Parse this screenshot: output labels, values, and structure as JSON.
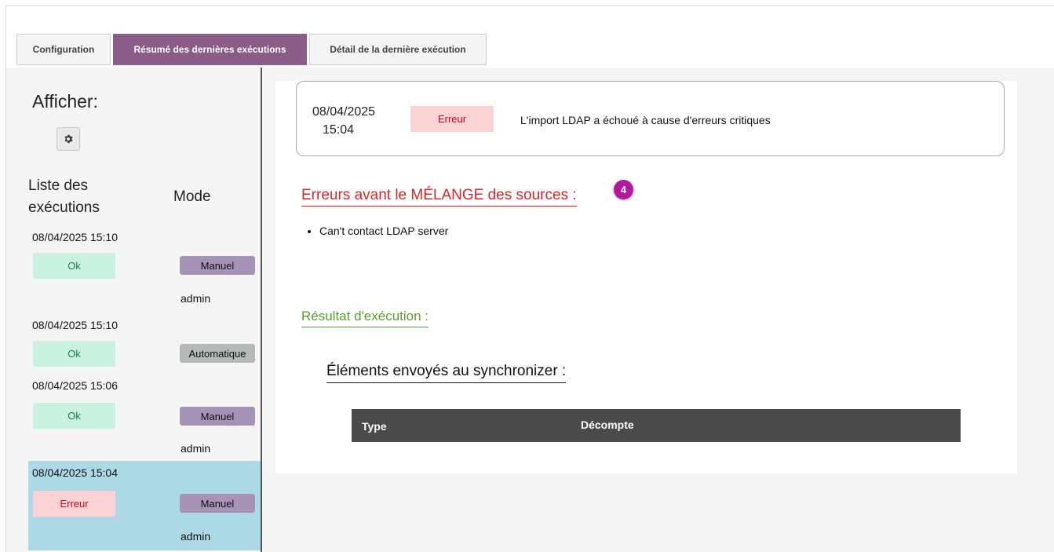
{
  "tabs": [
    {
      "label": "Configuration",
      "active": false
    },
    {
      "label": "Résumé des dernières exécutions",
      "active": true
    },
    {
      "label": "Détail de la dernière exécution",
      "active": false
    }
  ],
  "sidebar": {
    "afficher_label": "Afficher:",
    "settings_icon": "gear-icon",
    "list_header": "Liste des exécutions",
    "mode_header": "Mode",
    "runs": [
      {
        "date": "08/04/2025 15:10",
        "status": "Ok",
        "mode": "Manuel",
        "user": "admin"
      },
      {
        "date": "08/04/2025 15:10",
        "status": "Ok",
        "mode": "Automatique",
        "user": ""
      },
      {
        "date": "08/04/2025 15:06",
        "status": "Ok",
        "mode": "Manuel",
        "user": "admin"
      },
      {
        "date": "08/04/2025 15:04",
        "status": "Erreur",
        "mode": "Manuel",
        "user": "admin",
        "selected": true
      }
    ]
  },
  "detail": {
    "summary": {
      "date": "08/04/2025",
      "time": "15:04",
      "status": "Erreur",
      "message": "L'import LDAP a échoué à cause d'erreurs critiques"
    },
    "errors_title": "Erreurs avant le MÉLANGE des sources :",
    "step_badge": "4",
    "errors": [
      "Can't contact LDAP server"
    ],
    "result_title": "Résultat d'exécution :",
    "sync_title": "Éléments envoyés au synchronizer :",
    "table_headers": [
      "Type",
      "Décompte"
    ]
  },
  "colors": {
    "accent": "#8b5c87",
    "ok_bg": "#c9f3e0",
    "error_bg": "#fbd3d5",
    "manual_bg": "#a792b8",
    "auto_bg": "#b5bab6",
    "selected_bg": "#add8e6",
    "error_title": "#d62828",
    "result_title": "#5aa02c",
    "badge": "#b5179e"
  }
}
